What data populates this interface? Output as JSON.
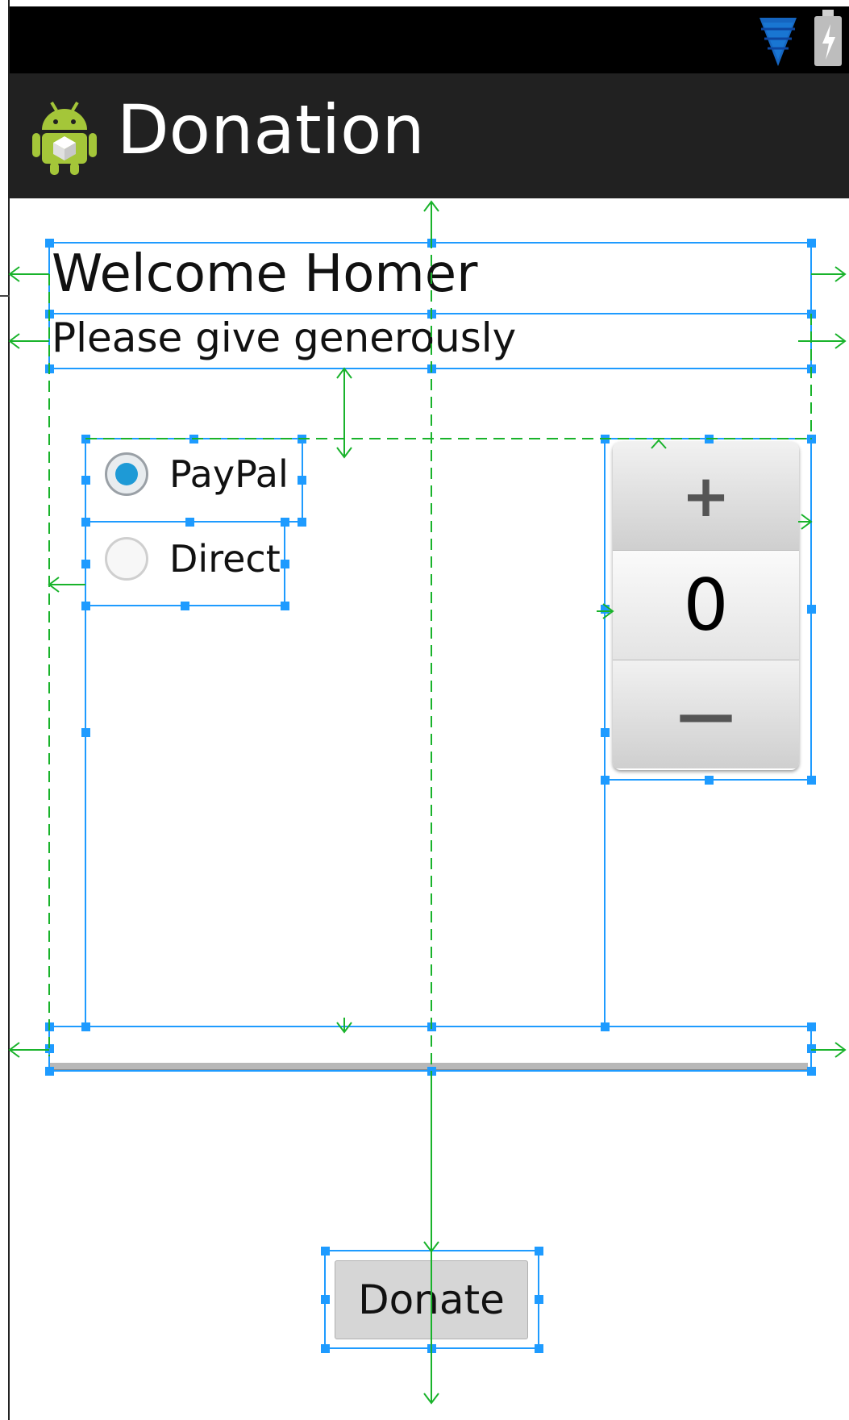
{
  "app": {
    "title": "Donation"
  },
  "header": {
    "welcome": "Welcome Homer",
    "subtitle": "Please give generously"
  },
  "payment": {
    "options": [
      {
        "label": "PayPal",
        "checked": true
      },
      {
        "label": "Direct",
        "checked": false
      }
    ]
  },
  "amount_picker": {
    "increment_symbol": "+",
    "value": "0",
    "decrement_symbol": "—"
  },
  "progress": {
    "fraction": 0
  },
  "actions": {
    "donate_label": "Donate"
  },
  "icons": {
    "status_wifi": "wifi-icon",
    "status_battery": "battery-charging-icon",
    "app": "android-icon"
  },
  "colors": {
    "action_bar": "#212121",
    "status_bar": "#000000",
    "radio_checked": "#1e9ad6",
    "selection_blue": "#1e9bff",
    "guide_green": "#19b32b"
  }
}
